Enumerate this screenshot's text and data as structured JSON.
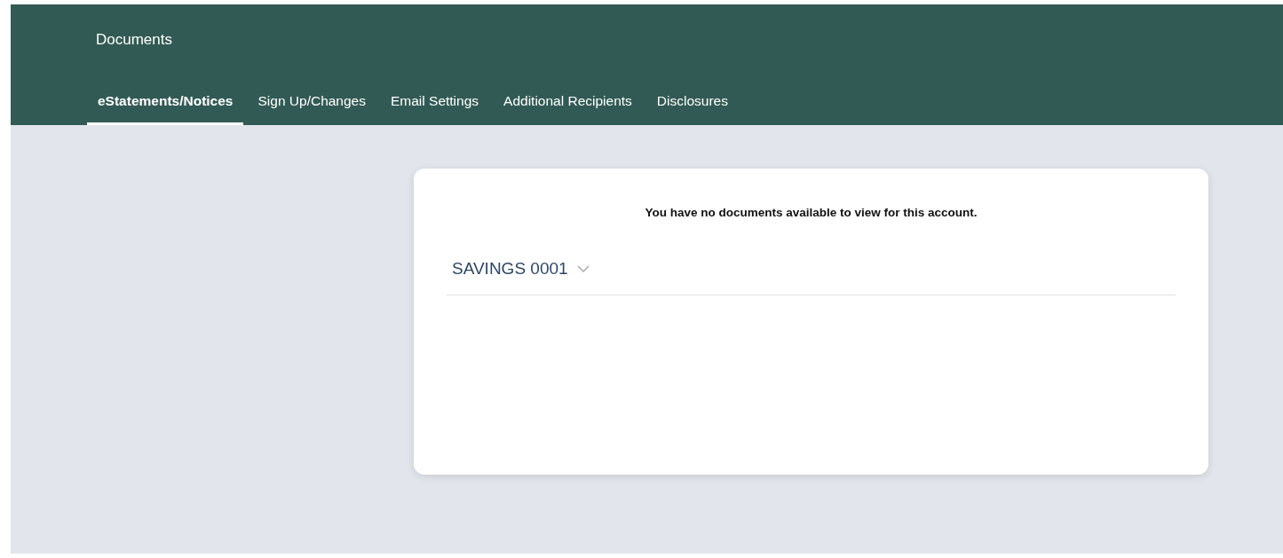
{
  "header": {
    "title": "Documents"
  },
  "tabs": [
    {
      "label": "eStatements/Notices",
      "selected": true
    },
    {
      "label": "Sign Up/Changes",
      "selected": false
    },
    {
      "label": "Email Settings",
      "selected": false
    },
    {
      "label": "Additional Recipients",
      "selected": false
    },
    {
      "label": "Disclosures",
      "selected": false
    }
  ],
  "card": {
    "message": "You have no documents available to view for this account.",
    "account_selector": {
      "value": "SAVINGS 0001",
      "expanded": false
    }
  }
}
